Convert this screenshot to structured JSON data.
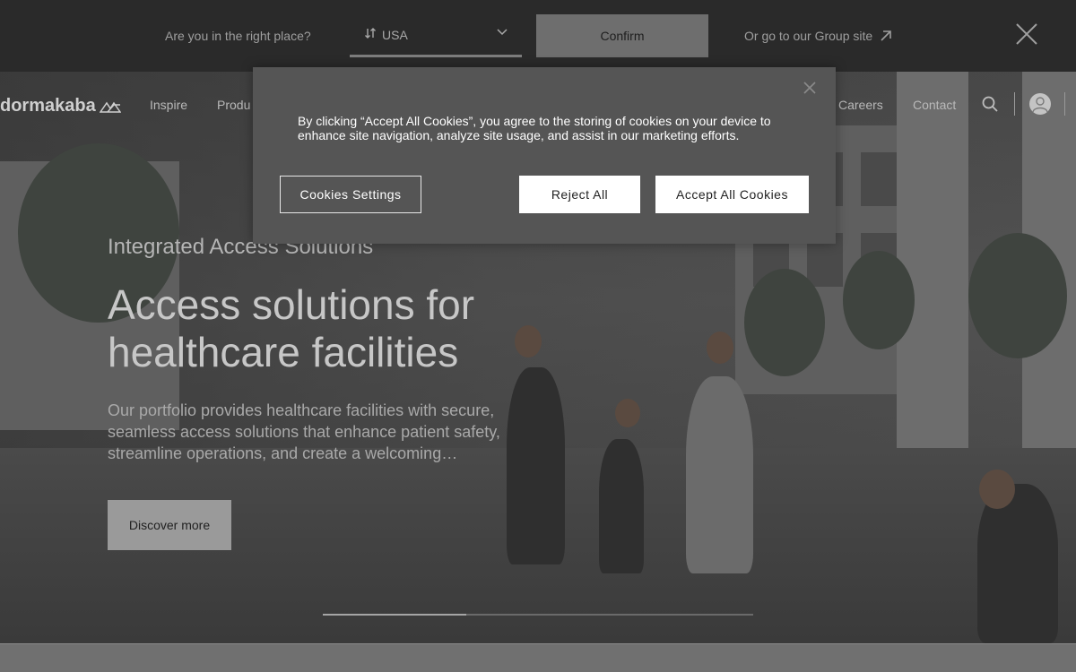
{
  "country_banner": {
    "question": "Are you in the right place?",
    "selected_country": "USA",
    "confirm_label": "Confirm",
    "group_link": "Or go to our Group site"
  },
  "nav": {
    "logo": "dormakaba",
    "items_left": [
      "Inspire",
      "Produ"
    ],
    "items_right": [
      "Careers",
      "Contact"
    ]
  },
  "hero": {
    "eyebrow": "Integrated Access Solutions",
    "title": "Access solutions for healthcare facilities",
    "description": "Our portfolio provides healthcare facilities with secure, seamless access solutions that enhance patient safety, streamline operations, and create a welcoming…",
    "cta_label": "Discover more",
    "progress_fraction": 0.333
  },
  "cookie_dialog": {
    "text": "By clicking “Accept All Cookies”, you agree to the storing of cookies on your device to enhance site navigation, analyze site usage, and assist in our marketing efforts.",
    "settings_label": "Cookies Settings",
    "reject_label": "Reject All",
    "accept_label": "Accept All Cookies"
  },
  "colors": {
    "banner_bg": "#2a2a2a",
    "dialog_bg": "#555555",
    "button_white": "#ffffff"
  },
  "icons": [
    "sort-arrows-icon",
    "chevron-down-icon",
    "external-arrow-icon",
    "close-icon",
    "logo-mark-icon",
    "search-icon",
    "user-avatar-icon",
    "dialog-close-icon"
  ]
}
